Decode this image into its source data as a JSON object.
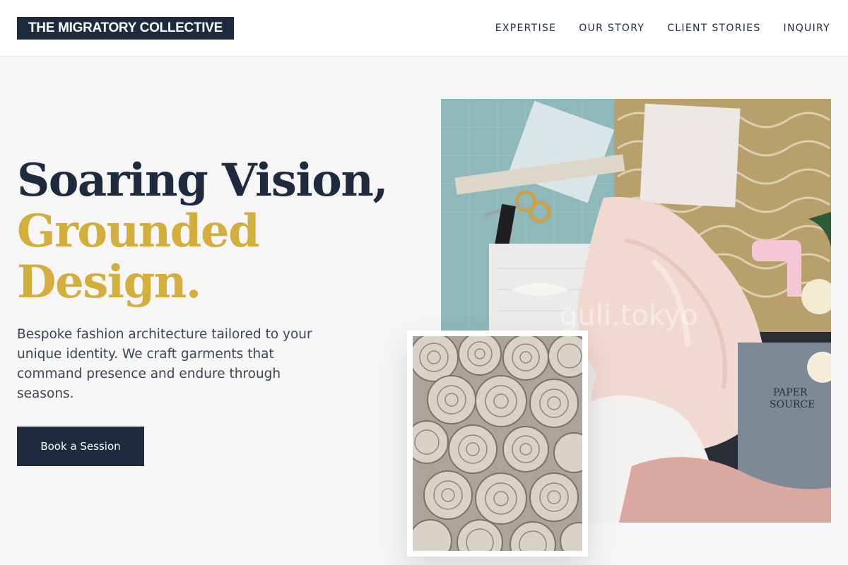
{
  "header": {
    "logo": "THE MIGRATORY COLLECTIVE",
    "nav": [
      "EXPERTISE",
      "OUR STORY",
      "CLIENT STORIES",
      "INQUIRY"
    ]
  },
  "hero": {
    "title_line1": "Soaring Vision,",
    "title_line2": "Grounded",
    "title_line3": "Design.",
    "subtitle": "Bespoke fashion architecture tailored to your unique identity. We craft garments that command presence and endure through seasons.",
    "cta": "Book a Session"
  },
  "images": {
    "main_watermark": "guli.tokyo",
    "card_title_1": "PAPER",
    "card_title_2": "SOURCE"
  },
  "colors": {
    "navy": "#1e2a3e",
    "gold": "#d4ae3d",
    "background": "#f6f6f6"
  }
}
